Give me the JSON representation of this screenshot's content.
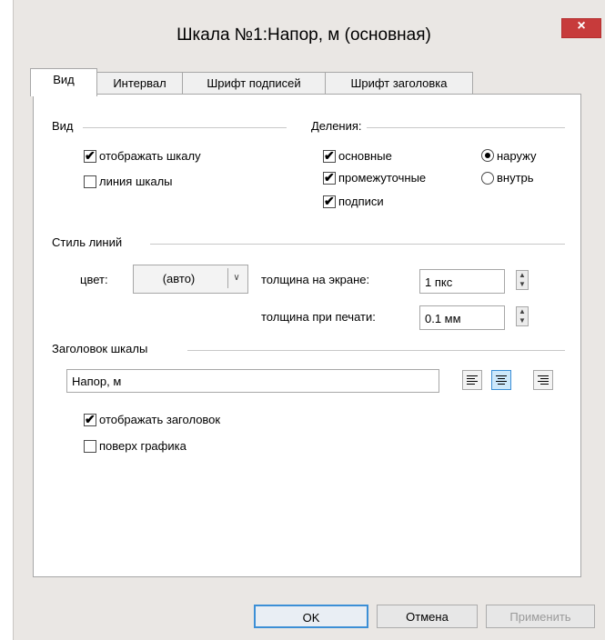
{
  "title": "Шкала №1:Напор, м (основная)",
  "close_glyph": "×",
  "tabs": [
    "Вид",
    "Интервал",
    "Шрифт подписей",
    "Шрифт заголовка"
  ],
  "vid": {
    "heading": "Вид",
    "show_scale": "отображать шкалу",
    "show_scale_checked": true,
    "scale_line": "линия шкалы",
    "scale_line_checked": false
  },
  "divisions": {
    "heading": "Деления:",
    "main": "основные",
    "intermediate": "промежуточные",
    "labels": "подписи",
    "outward": "наружу",
    "inward": "внутрь",
    "selected": "наружу"
  },
  "line_style": {
    "heading": "Стиль линий",
    "color_label": "цвет:",
    "color_value": "(авто)",
    "screen_thickness_label": "толщина на экране:",
    "screen_thickness_value": "1 пкс",
    "print_thickness_label": "толщина при печати:",
    "print_thickness_value": "0.1 мм"
  },
  "scale_title": {
    "heading": "Заголовок шкалы",
    "value": "Напор, м",
    "show_title": "отображать заголовок",
    "show_title_checked": true,
    "over_chart": "поверх графика",
    "over_chart_checked": false,
    "alignment": "center"
  },
  "buttons": {
    "ok": "OK",
    "cancel": "Отмена",
    "apply": "Применить"
  },
  "colors": {
    "close_bg": "#c73b3b",
    "accent": "#3c8fd6"
  }
}
